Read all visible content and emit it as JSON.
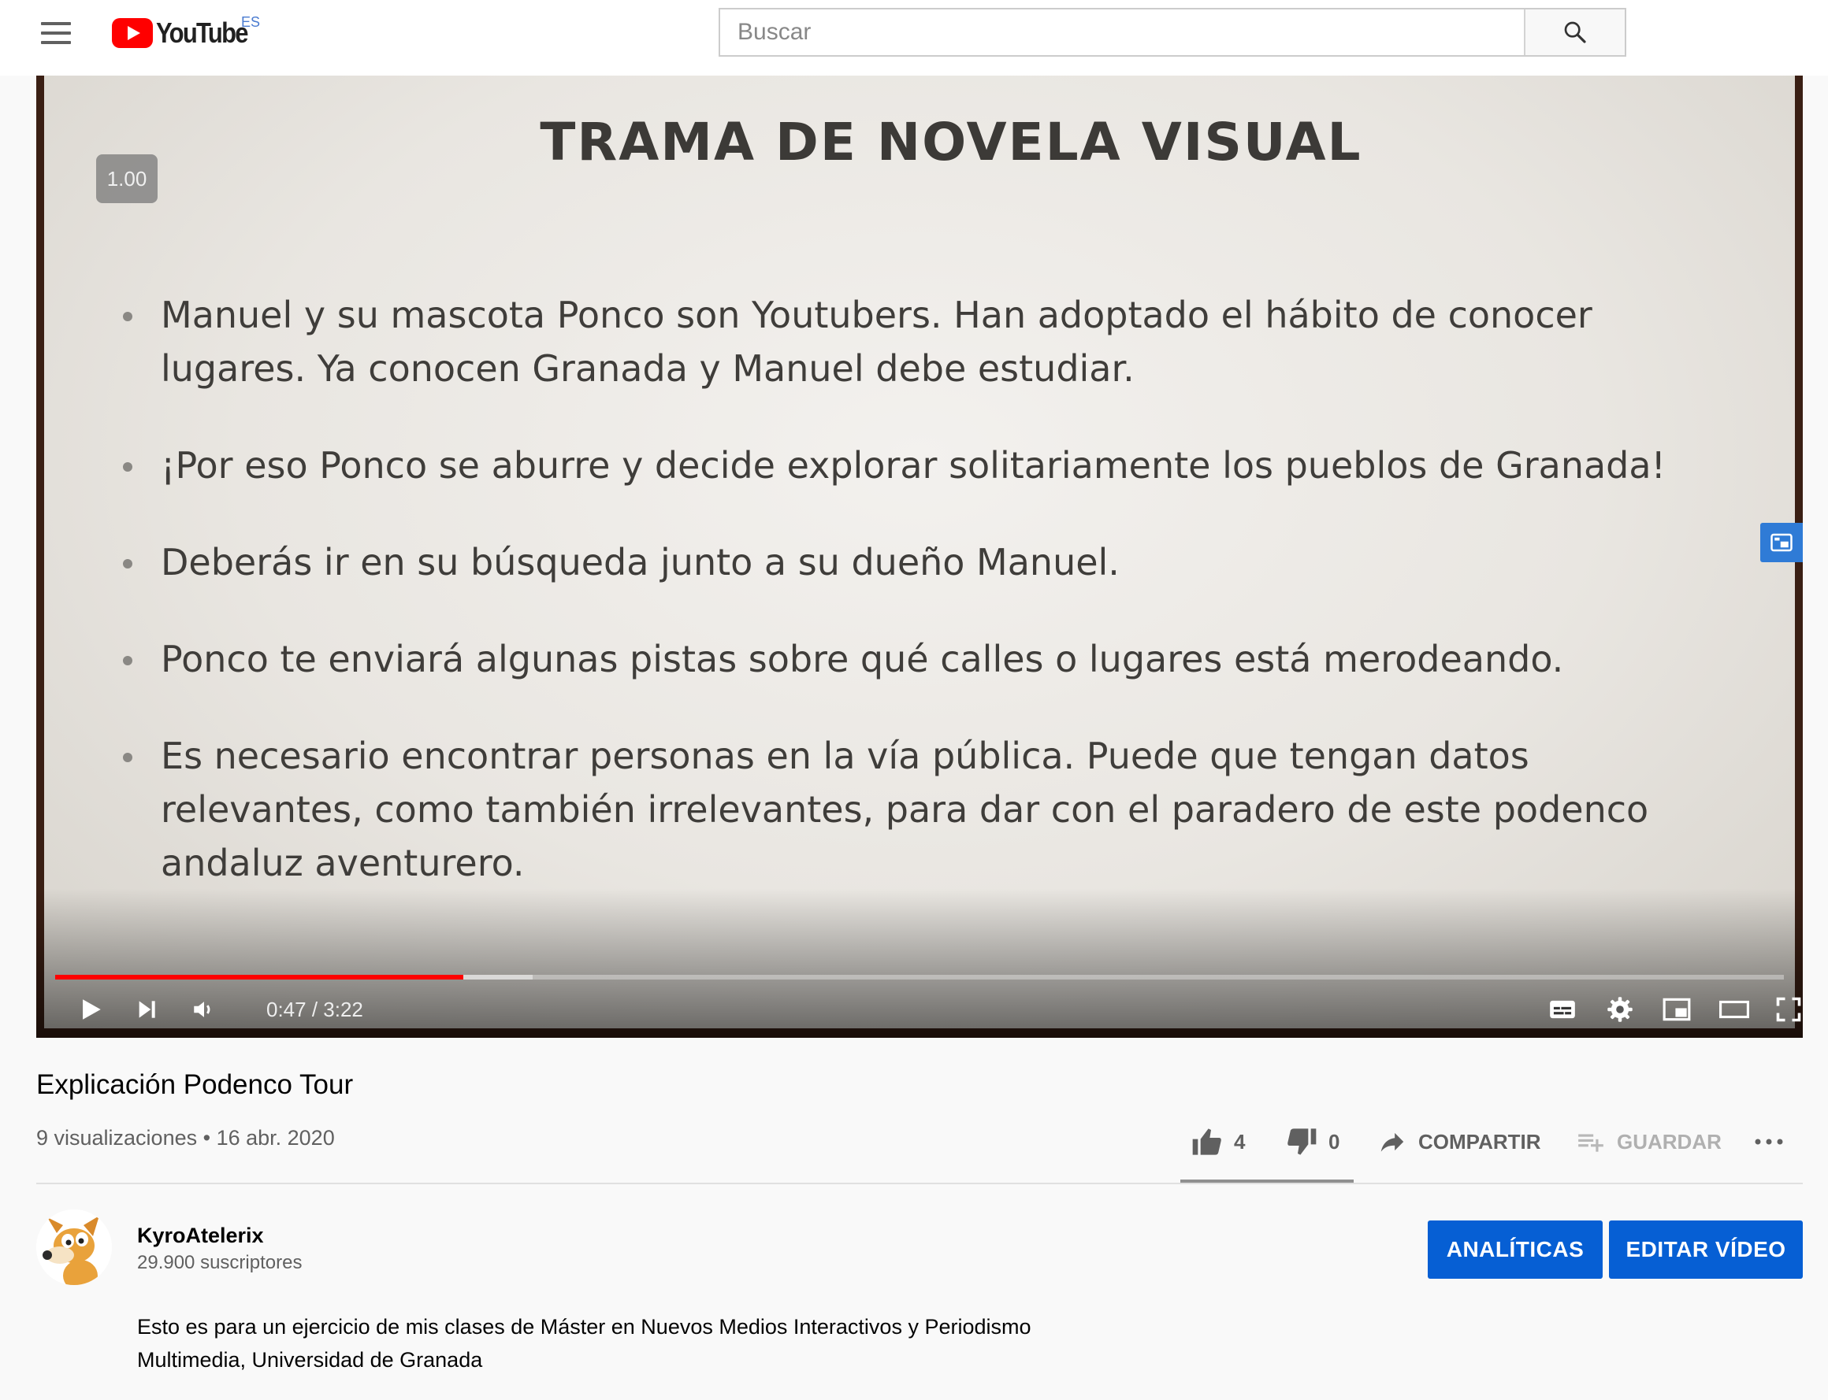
{
  "header": {
    "logo_text": "YouTube",
    "region_code": "ES",
    "search_placeholder": "Buscar"
  },
  "player": {
    "speed": "1.00",
    "slide_title": "TRAMA DE NOVELA VISUAL",
    "bullets": [
      "Manuel y su mascota Ponco son Youtubers. Han adoptado el hábito de conocer lugares. Ya conocen Granada y Manuel debe estudiar.",
      "¡Por eso Ponco se aburre y decide explorar solitariamente los pueblos de Granada!",
      "Deberás ir en su búsqueda junto a su dueño Manuel.",
      "Ponco te enviará algunas pistas sobre qué calles o lugares está merodeando.",
      "Es necesario encontrar personas en la vía pública. Puede que tengan datos relevantes, como también irrelevantes, para dar con el paradero de este podenco andaluz aventurero."
    ],
    "current_time": "0:47",
    "time_separator": " / ",
    "duration": "3:22",
    "progress_fraction": 0.236,
    "colors": {
      "progress": "#ff0000"
    }
  },
  "video": {
    "title": "Explicación Podenco Tour",
    "views": "9 visualizaciones",
    "separator": " • ",
    "date": "16 abr. 2020",
    "likes": "4",
    "dislikes": "0",
    "share_label": "COMPARTIR",
    "save_label": "GUARDAR"
  },
  "channel": {
    "name": "KyroAtelerix",
    "subscribers": "29.900 suscriptores",
    "analytics_label": "ANALÍTICAS",
    "edit_label": "EDITAR VÍDEO",
    "description": "Esto es para un ejercicio de mis clases de Máster en Nuevos Medios Interactivos y Periodismo Multimedia, Universidad de Granada"
  },
  "icons": {
    "menu": "hamburger-menu-icon",
    "search": "search-icon",
    "play": "play-icon",
    "next": "next-icon",
    "volume": "volume-icon",
    "subtitles": "subtitles-icon",
    "settings": "gear-icon",
    "miniplayer": "miniplayer-icon",
    "theater": "theater-mode-icon",
    "fullscreen": "fullscreen-icon",
    "like": "thumbs-up-icon",
    "dislike": "thumbs-down-icon",
    "share": "share-arrow-icon",
    "save": "playlist-add-icon",
    "more": "more-horizontal-icon"
  }
}
